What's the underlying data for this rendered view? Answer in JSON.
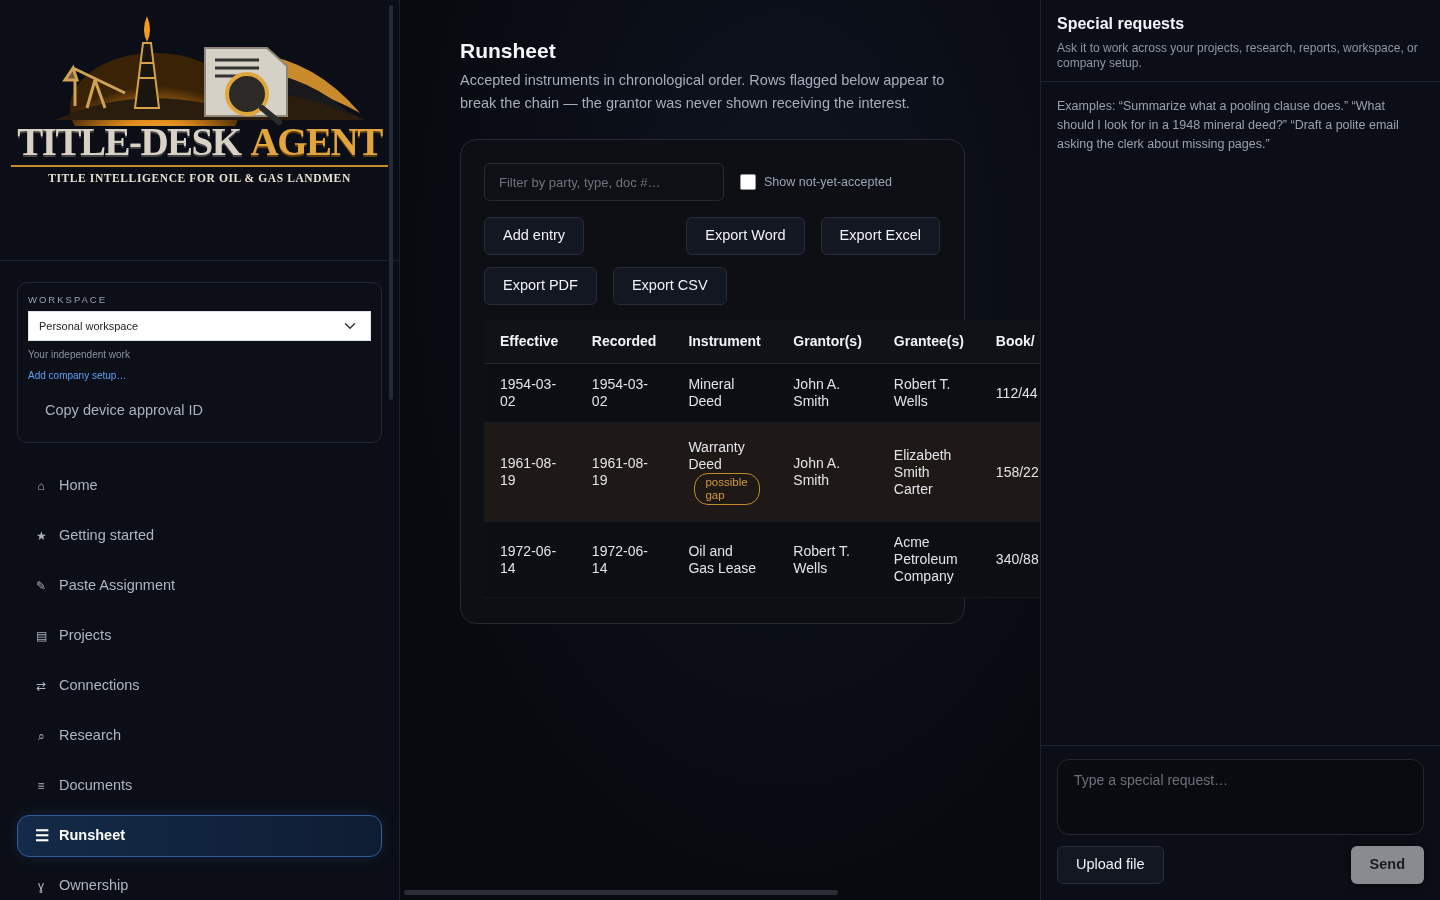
{
  "logo": {
    "title": "TITLE-DESK",
    "title_accent": "AGENT",
    "tagline": "TITLE INTELLIGENCE FOR OIL & GAS LANDMEN"
  },
  "workspace": {
    "label": "WORKSPACE",
    "value": "Personal workspace",
    "note": "Your independent work",
    "link": "Add company setup…",
    "copy_button": "Copy device approval ID"
  },
  "nav": [
    {
      "icon": "⌂",
      "label": "Home",
      "selected": false
    },
    {
      "icon": "★",
      "label": "Getting started",
      "selected": false
    },
    {
      "icon": "✎",
      "label": "Paste Assignment",
      "selected": false
    },
    {
      "icon": "▤",
      "label": "Projects",
      "selected": false
    },
    {
      "icon": "⇄",
      "label": "Connections",
      "selected": false
    },
    {
      "icon": "⌕",
      "label": "Research",
      "selected": false
    },
    {
      "icon": "≡",
      "label": "Documents",
      "selected": false
    },
    {
      "icon": "☰",
      "label": "Runsheet",
      "selected": true
    },
    {
      "icon": "ɣ",
      "label": "Ownership",
      "selected": false
    }
  ],
  "page": {
    "title": "Runsheet",
    "description": "Accepted instruments in chronological order. Rows flagged below appear to break the chain — the grantor was never shown receiving the interest."
  },
  "filter": {
    "placeholder": "Filter by party, type, doc #…"
  },
  "show_not_yet_accepted": {
    "label": "Show not-yet-accepted",
    "checked": false
  },
  "actions": {
    "primary": [
      "Add entry"
    ],
    "exports_top": [
      "Export Word",
      "Export Excel"
    ],
    "exports_bottom": [
      "Export PDF",
      "Export CSV"
    ]
  },
  "table": {
    "columns": [
      "Effective",
      "Recorded",
      "Instrument",
      "Grantor(s)",
      "Grantee(s)",
      "Book/"
    ],
    "rows": [
      {
        "effective": "1954-03-02",
        "recorded": "1954-03-02",
        "instrument": "Mineral Deed",
        "grantors": "John A. Smith",
        "grantees": "Robert T. Wells",
        "book_page": "112/44",
        "flagged": false
      },
      {
        "effective": "1961-08-19",
        "recorded": "1961-08-19",
        "instrument": "Warranty Deed",
        "flag_label": "possible gap",
        "grantors": "John A. Smith",
        "grantees": "Elizabeth Smith Carter",
        "book_page": "158/22",
        "flagged": true
      },
      {
        "effective": "1972-06-14",
        "recorded": "1972-06-14",
        "instrument": "Oil and Gas Lease",
        "grantors": "Robert T. Wells",
        "grantees": "Acme Petroleum Company",
        "book_page": "340/88",
        "flagged": false
      }
    ]
  },
  "assistant": {
    "title": "Special requests",
    "subtitle": "Ask it to work across your projects, research, reports, workspace, or company setup.",
    "examples": "Examples: “Summarize what a pooling clause does.” “What should I look for in a 1948 mineral deed?” “Draft a polite email asking the clerk about missing pages.”",
    "input_placeholder": "Type a special request…",
    "upload_button": "Upload file",
    "send_button": "Send"
  }
}
